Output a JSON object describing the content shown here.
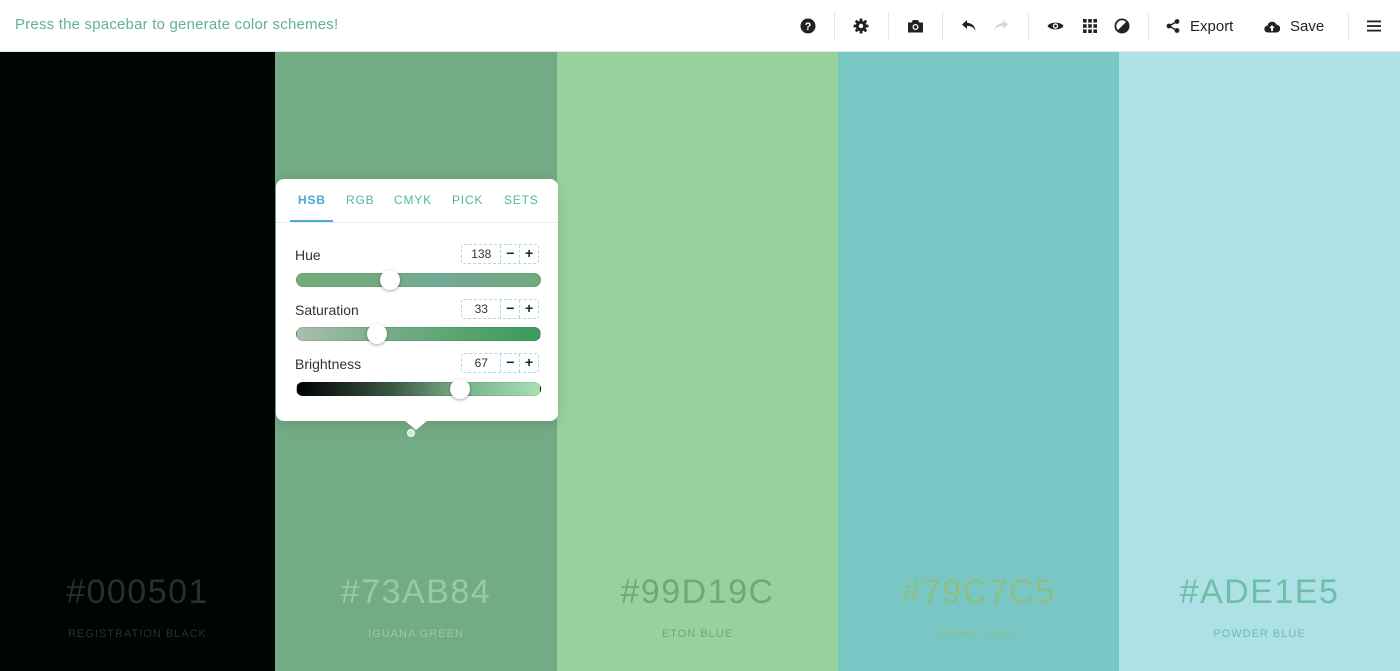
{
  "header": {
    "hint": "Press the spacebar to generate color schemes!",
    "export_label": "Export",
    "save_label": "Save"
  },
  "icons": {
    "help": "question-circle-icon",
    "settings": "gear-icon",
    "screenshot": "camera-icon",
    "undo": "undo-icon",
    "redo": "redo-icon",
    "view": "eye-icon",
    "grid": "grid-icon",
    "contrast": "contrast-icon",
    "share": "share-icon",
    "save": "cloud-upload-icon",
    "menu": "hamburger-menu-icon"
  },
  "palette": [
    {
      "hex": "#000501",
      "name": "REGISTRATION BLACK",
      "bg": "#000501",
      "text": "#2b2f2c"
    },
    {
      "hex": "#73AB84",
      "name": "IGUANA GREEN",
      "bg": "#73AB84",
      "text": "#97cba3"
    },
    {
      "hex": "#99D19C",
      "name": "ETON BLUE",
      "bg": "#99D19C",
      "text": "#6fa874"
    },
    {
      "hex": "#79C7C5",
      "name": "PEARL AQUA",
      "bg": "#79C7C5",
      "text": "#8cbe87"
    },
    {
      "hex": "#ADE1E5",
      "name": "POWDER BLUE",
      "bg": "#ADE1E5",
      "text": "#6dbfa8"
    }
  ],
  "picker": {
    "tabs": [
      "HSB",
      "RGB",
      "CMYK",
      "PICK",
      "SETS"
    ],
    "active_tab": "HSB",
    "hue": {
      "label": "Hue",
      "value": "138",
      "level": 138,
      "max": 360
    },
    "saturation": {
      "label": "Saturation",
      "value": "33",
      "level": 33,
      "max": 100
    },
    "brightness": {
      "label": "Brightness",
      "value": "67",
      "level": 67,
      "max": 100
    },
    "minus": "−",
    "plus": "+"
  }
}
